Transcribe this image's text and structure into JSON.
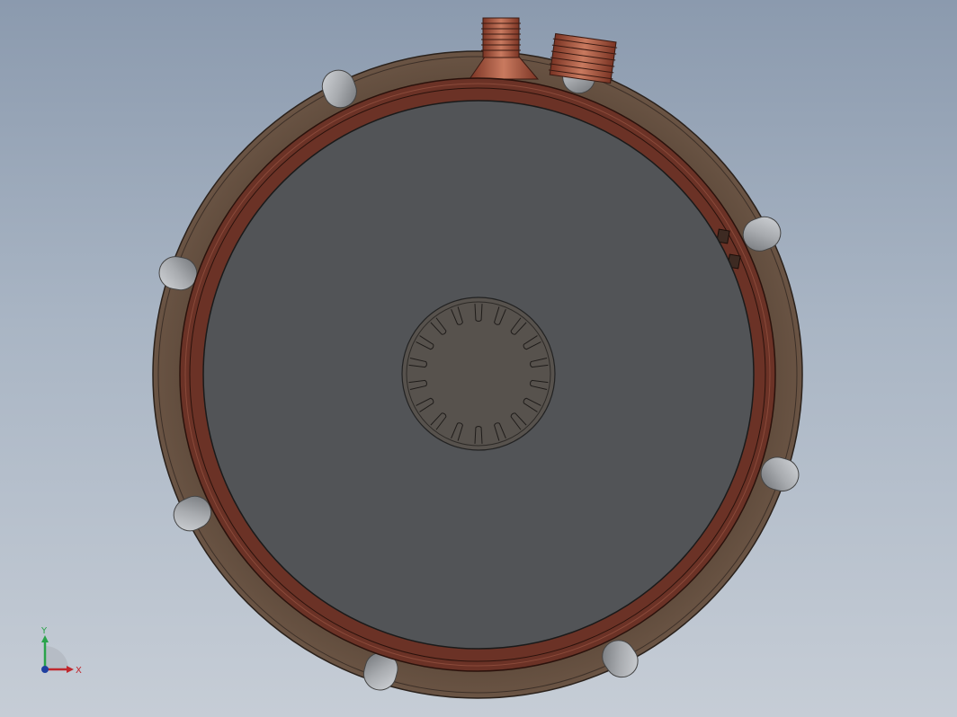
{
  "model_view": {
    "colors": {
      "background_top": "#8b9aae",
      "background_bottom": "#c6cdd6",
      "housing": "#5e4a3c",
      "copper_ring": "#6b3226",
      "copper_ring_light": "#8a4a3a",
      "disk_face": "#525457",
      "hub_face": "#57524d",
      "knob": "#a8abaf",
      "fitting": "#a0533f"
    },
    "spline_teeth_count": 18,
    "knob_count": 8,
    "fitting_count": 2
  },
  "triad": {
    "x_label": "X",
    "y_label": "Y",
    "x_color": "#c0272d",
    "y_color": "#2aa34a",
    "z_color": "#1f3fa0"
  }
}
